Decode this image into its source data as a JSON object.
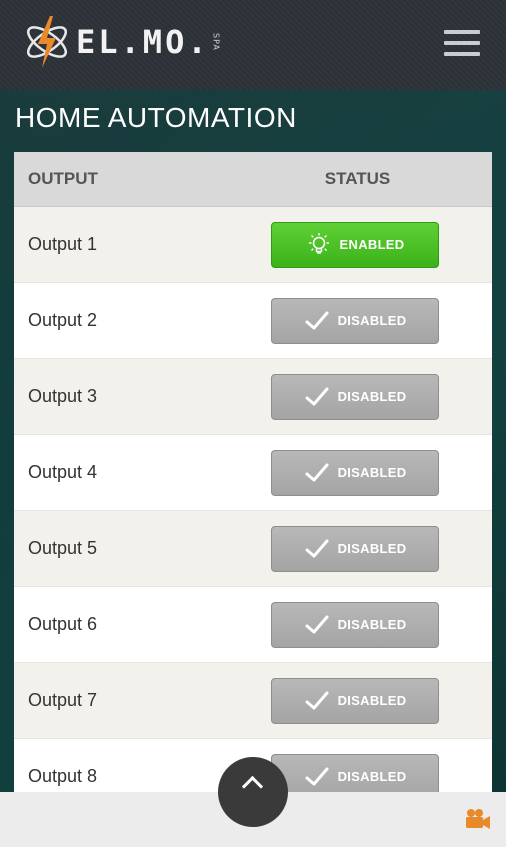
{
  "brand": {
    "name": "EL.MO.",
    "suffix": "SPA"
  },
  "page": {
    "title": "HOME AUTOMATION"
  },
  "table": {
    "headers": {
      "output": "OUTPUT",
      "status": "STATUS"
    },
    "rows": [
      {
        "label": "Output 1",
        "status": "ENABLED",
        "icon": "lightbulb-icon"
      },
      {
        "label": "Output 2",
        "status": "DISABLED",
        "icon": "checkmark-icon"
      },
      {
        "label": "Output 3",
        "status": "DISABLED",
        "icon": "checkmark-icon"
      },
      {
        "label": "Output 4",
        "status": "DISABLED",
        "icon": "checkmark-icon"
      },
      {
        "label": "Output 5",
        "status": "DISABLED",
        "icon": "checkmark-icon"
      },
      {
        "label": "Output 6",
        "status": "DISABLED",
        "icon": "checkmark-icon"
      },
      {
        "label": "Output 7",
        "status": "DISABLED",
        "icon": "checkmark-icon"
      },
      {
        "label": "Output 8",
        "status": "DISABLED",
        "icon": "checkmark-icon"
      }
    ]
  },
  "colors": {
    "enabled": "#3bb21a",
    "disabled": "#a8a8a8",
    "accent": "#e8892a"
  },
  "icons": {
    "menu": "hamburger-menu-icon",
    "camera": "video-camera-icon",
    "scroll": "chevron-up-icon"
  }
}
